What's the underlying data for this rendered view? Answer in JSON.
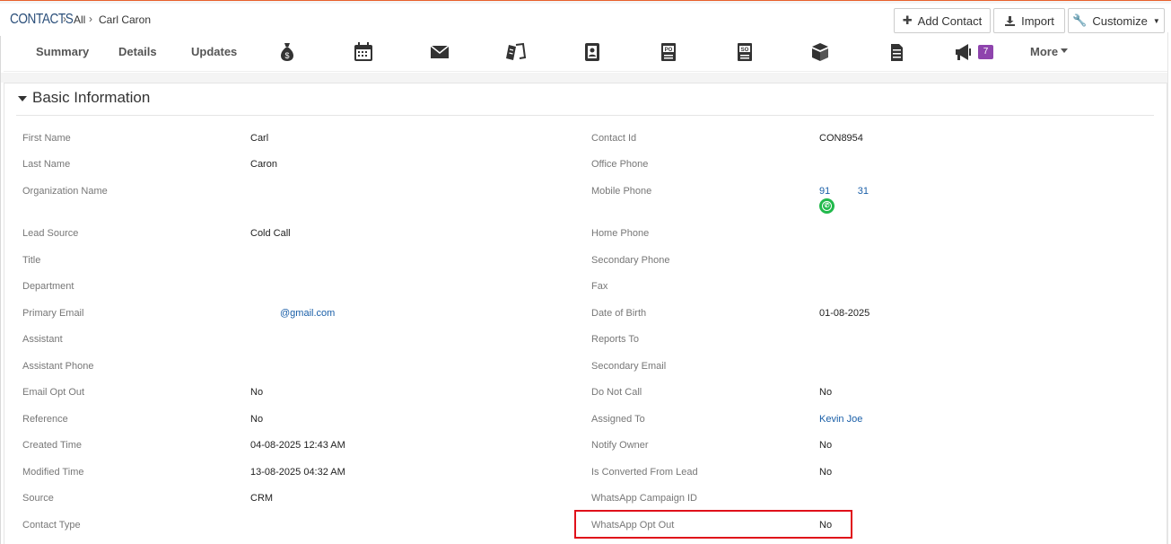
{
  "header": {
    "module": "CONTACTS",
    "crumb_all": "All",
    "crumb_record": "Carl Caron",
    "add_contact": "Add Contact",
    "import": "Import",
    "customize": "Customize"
  },
  "tabs": {
    "summary": "Summary",
    "details": "Details",
    "updates": "Updates",
    "campaign_badge": "7",
    "more": "More"
  },
  "section": {
    "title": "Basic Information"
  },
  "left_fields": [
    {
      "label": "First Name",
      "value": "Carl"
    },
    {
      "label": "Last Name",
      "value": "Caron"
    },
    {
      "label": "Organization Name",
      "value": ""
    },
    {
      "label": "Lead Source",
      "value": "Cold Call"
    },
    {
      "label": "Title",
      "value": ""
    },
    {
      "label": "Department",
      "value": ""
    },
    {
      "label": "Primary Email",
      "value": "@gmail.com"
    },
    {
      "label": "Assistant",
      "value": ""
    },
    {
      "label": "Assistant Phone",
      "value": ""
    },
    {
      "label": "Email Opt Out",
      "value": "No"
    },
    {
      "label": "Reference",
      "value": "No"
    },
    {
      "label": "Created Time",
      "value": "04-08-2025 12:43 AM"
    },
    {
      "label": "Modified Time",
      "value": "13-08-2025 04:32 AM"
    },
    {
      "label": "Source",
      "value": "CRM"
    },
    {
      "label": "Contact Type",
      "value": ""
    }
  ],
  "right_fields": [
    {
      "label": "Contact Id",
      "value": "CON8954"
    },
    {
      "label": "Office Phone",
      "value": ""
    },
    {
      "label": "Mobile Phone",
      "value": "91          31"
    },
    {
      "label": "Home Phone",
      "value": ""
    },
    {
      "label": "Secondary Phone",
      "value": ""
    },
    {
      "label": "Fax",
      "value": ""
    },
    {
      "label": "Date of Birth",
      "value": "01-08-2025"
    },
    {
      "label": "Reports To",
      "value": ""
    },
    {
      "label": "Secondary Email",
      "value": ""
    },
    {
      "label": "Do Not Call",
      "value": "No"
    },
    {
      "label": "Assigned To",
      "value": "Kevin Joe"
    },
    {
      "label": "Notify Owner",
      "value": "No"
    },
    {
      "label": "Is Converted From Lead",
      "value": "No"
    },
    {
      "label": "WhatsApp Campaign ID",
      "value": ""
    },
    {
      "label": "WhatsApp Opt Out",
      "value": "No"
    }
  ],
  "colors": {
    "accent_orange": "#e8602c",
    "link_blue": "#1a5fa8",
    "whatsapp_green": "#21b94b",
    "badge_purple": "#8e44ad",
    "highlight_red": "#e0101a"
  }
}
